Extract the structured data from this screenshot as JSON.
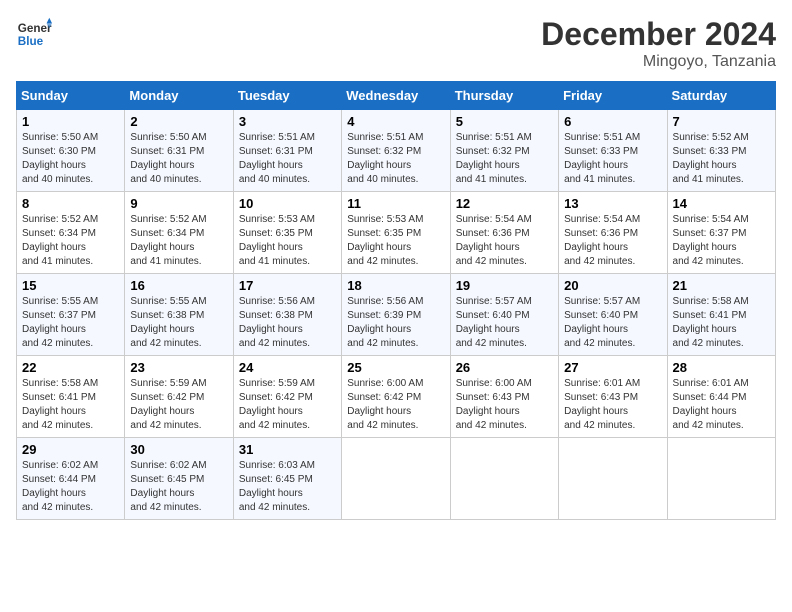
{
  "header": {
    "logo_line1": "General",
    "logo_line2": "Blue",
    "title": "December 2024",
    "subtitle": "Mingoyo, Tanzania"
  },
  "weekdays": [
    "Sunday",
    "Monday",
    "Tuesday",
    "Wednesday",
    "Thursday",
    "Friday",
    "Saturday"
  ],
  "weeks": [
    [
      {
        "day": "1",
        "sunrise": "5:50 AM",
        "sunset": "6:30 PM",
        "daylight": "12 hours and 40 minutes."
      },
      {
        "day": "2",
        "sunrise": "5:50 AM",
        "sunset": "6:31 PM",
        "daylight": "12 hours and 40 minutes."
      },
      {
        "day": "3",
        "sunrise": "5:51 AM",
        "sunset": "6:31 PM",
        "daylight": "12 hours and 40 minutes."
      },
      {
        "day": "4",
        "sunrise": "5:51 AM",
        "sunset": "6:32 PM",
        "daylight": "12 hours and 40 minutes."
      },
      {
        "day": "5",
        "sunrise": "5:51 AM",
        "sunset": "6:32 PM",
        "daylight": "12 hours and 41 minutes."
      },
      {
        "day": "6",
        "sunrise": "5:51 AM",
        "sunset": "6:33 PM",
        "daylight": "12 hours and 41 minutes."
      },
      {
        "day": "7",
        "sunrise": "5:52 AM",
        "sunset": "6:33 PM",
        "daylight": "12 hours and 41 minutes."
      }
    ],
    [
      {
        "day": "8",
        "sunrise": "5:52 AM",
        "sunset": "6:34 PM",
        "daylight": "12 hours and 41 minutes."
      },
      {
        "day": "9",
        "sunrise": "5:52 AM",
        "sunset": "6:34 PM",
        "daylight": "12 hours and 41 minutes."
      },
      {
        "day": "10",
        "sunrise": "5:53 AM",
        "sunset": "6:35 PM",
        "daylight": "12 hours and 41 minutes."
      },
      {
        "day": "11",
        "sunrise": "5:53 AM",
        "sunset": "6:35 PM",
        "daylight": "12 hours and 42 minutes."
      },
      {
        "day": "12",
        "sunrise": "5:54 AM",
        "sunset": "6:36 PM",
        "daylight": "12 hours and 42 minutes."
      },
      {
        "day": "13",
        "sunrise": "5:54 AM",
        "sunset": "6:36 PM",
        "daylight": "12 hours and 42 minutes."
      },
      {
        "day": "14",
        "sunrise": "5:54 AM",
        "sunset": "6:37 PM",
        "daylight": "12 hours and 42 minutes."
      }
    ],
    [
      {
        "day": "15",
        "sunrise": "5:55 AM",
        "sunset": "6:37 PM",
        "daylight": "12 hours and 42 minutes."
      },
      {
        "day": "16",
        "sunrise": "5:55 AM",
        "sunset": "6:38 PM",
        "daylight": "12 hours and 42 minutes."
      },
      {
        "day": "17",
        "sunrise": "5:56 AM",
        "sunset": "6:38 PM",
        "daylight": "12 hours and 42 minutes."
      },
      {
        "day": "18",
        "sunrise": "5:56 AM",
        "sunset": "6:39 PM",
        "daylight": "12 hours and 42 minutes."
      },
      {
        "day": "19",
        "sunrise": "5:57 AM",
        "sunset": "6:40 PM",
        "daylight": "12 hours and 42 minutes."
      },
      {
        "day": "20",
        "sunrise": "5:57 AM",
        "sunset": "6:40 PM",
        "daylight": "12 hours and 42 minutes."
      },
      {
        "day": "21",
        "sunrise": "5:58 AM",
        "sunset": "6:41 PM",
        "daylight": "12 hours and 42 minutes."
      }
    ],
    [
      {
        "day": "22",
        "sunrise": "5:58 AM",
        "sunset": "6:41 PM",
        "daylight": "12 hours and 42 minutes."
      },
      {
        "day": "23",
        "sunrise": "5:59 AM",
        "sunset": "6:42 PM",
        "daylight": "12 hours and 42 minutes."
      },
      {
        "day": "24",
        "sunrise": "5:59 AM",
        "sunset": "6:42 PM",
        "daylight": "12 hours and 42 minutes."
      },
      {
        "day": "25",
        "sunrise": "6:00 AM",
        "sunset": "6:42 PM",
        "daylight": "12 hours and 42 minutes."
      },
      {
        "day": "26",
        "sunrise": "6:00 AM",
        "sunset": "6:43 PM",
        "daylight": "12 hours and 42 minutes."
      },
      {
        "day": "27",
        "sunrise": "6:01 AM",
        "sunset": "6:43 PM",
        "daylight": "12 hours and 42 minutes."
      },
      {
        "day": "28",
        "sunrise": "6:01 AM",
        "sunset": "6:44 PM",
        "daylight": "12 hours and 42 minutes."
      }
    ],
    [
      {
        "day": "29",
        "sunrise": "6:02 AM",
        "sunset": "6:44 PM",
        "daylight": "12 hours and 42 minutes."
      },
      {
        "day": "30",
        "sunrise": "6:02 AM",
        "sunset": "6:45 PM",
        "daylight": "12 hours and 42 minutes."
      },
      {
        "day": "31",
        "sunrise": "6:03 AM",
        "sunset": "6:45 PM",
        "daylight": "12 hours and 42 minutes."
      },
      null,
      null,
      null,
      null
    ]
  ]
}
